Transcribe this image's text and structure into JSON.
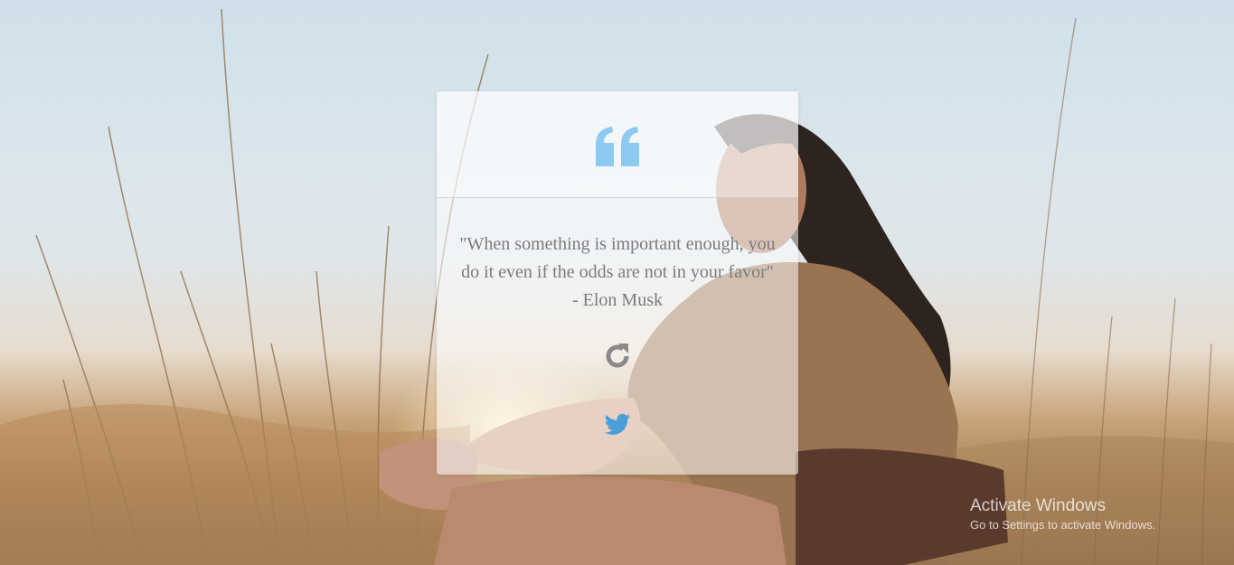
{
  "quote": {
    "text": "\"When something is important enough, you do it even if the odds are not in your favor\" - Elon Musk"
  },
  "icons": {
    "quote": "quote-left-icon",
    "refresh": "refresh-icon",
    "tweet": "twitter-icon"
  },
  "colors": {
    "quote_icon": "#8ccaf2",
    "twitter": "#4a9fd8",
    "refresh": "#8a8a8a",
    "text": "#7b7b7b"
  },
  "watermark": {
    "title": "Activate Windows",
    "subtitle": "Go to Settings to activate Windows."
  }
}
